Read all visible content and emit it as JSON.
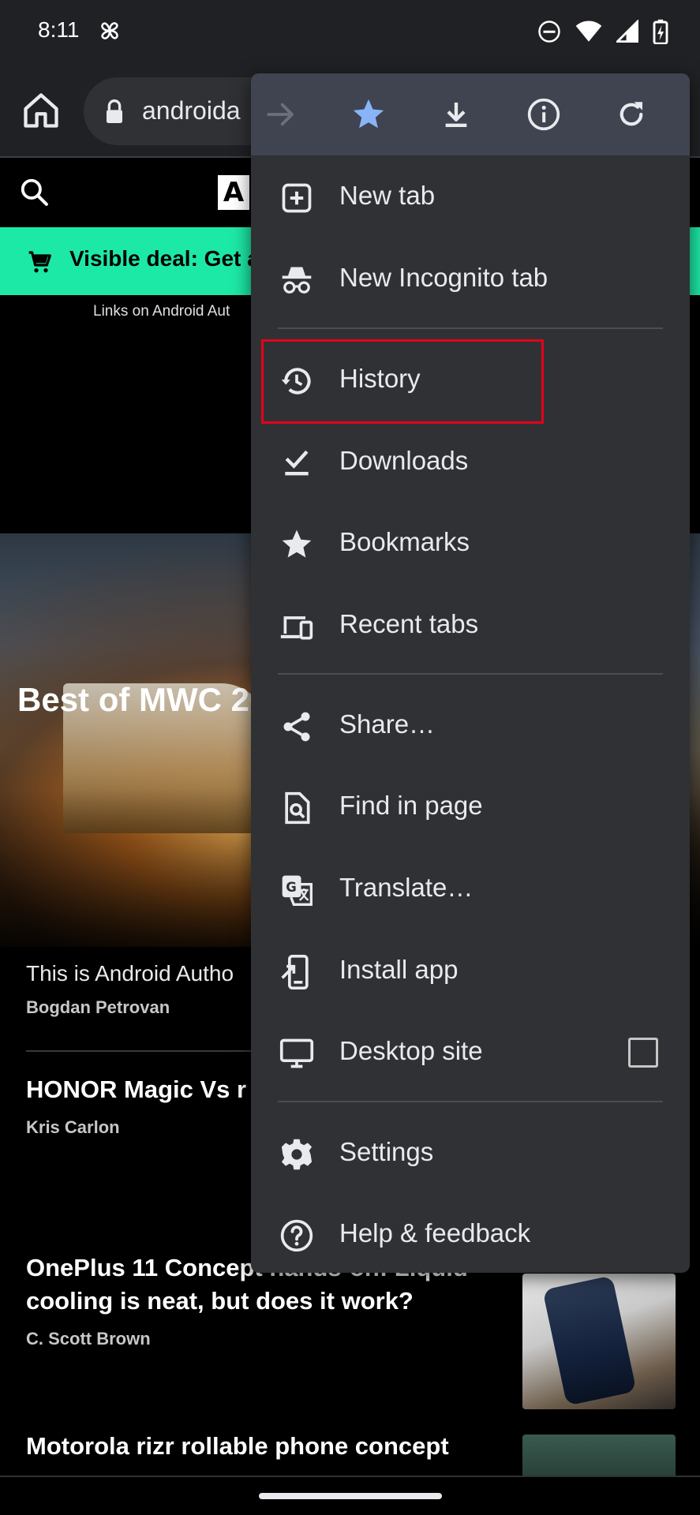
{
  "status_bar": {
    "time": "8:11",
    "icons": [
      "pinwheel-icon",
      "do-not-disturb-icon",
      "wifi-icon",
      "cellular-signal-icon",
      "battery-charging-icon"
    ]
  },
  "toolbar": {
    "url_text": "androida",
    "home_icon": "home-icon",
    "lock_icon": "lock-icon"
  },
  "page": {
    "site_logo_text": "A",
    "deal_text": "Visible deal: Get a",
    "affiliate_note": "Links on Android Aut",
    "hero_title": "Best of MWC 2023: products from",
    "articles": [
      {
        "title": "",
        "description": "This is Android Autho",
        "author": "Bogdan Petrovan"
      },
      {
        "title": "HONOR Magic Vs r believe in magic?",
        "author": "Kris Carlon"
      },
      {
        "title": "OnePlus 11 Concept hands-on: Liquid cooling is neat, but does it work?",
        "author": "C. Scott Brown"
      },
      {
        "title": "Motorola rizr rollable phone concept",
        "author": ""
      }
    ]
  },
  "menu": {
    "top_actions": [
      {
        "name": "forward-icon",
        "enabled": false
      },
      {
        "name": "bookmark-star-icon",
        "enabled": true
      },
      {
        "name": "download-icon",
        "enabled": true
      },
      {
        "name": "info-icon",
        "enabled": true
      },
      {
        "name": "refresh-icon",
        "enabled": true
      }
    ],
    "items": [
      {
        "label": "New tab",
        "icon": "new-tab-icon"
      },
      {
        "label": "New Incognito tab",
        "icon": "incognito-icon"
      },
      {
        "label": "History",
        "icon": "history-icon"
      },
      {
        "label": "Downloads",
        "icon": "downloads-icon"
      },
      {
        "label": "Bookmarks",
        "icon": "bookmarks-star-icon"
      },
      {
        "label": "Recent tabs",
        "icon": "recent-tabs-icon"
      },
      {
        "label": "Share…",
        "icon": "share-icon"
      },
      {
        "label": "Find in page",
        "icon": "find-in-page-icon"
      },
      {
        "label": "Translate…",
        "icon": "translate-icon"
      },
      {
        "label": "Install app",
        "icon": "install-app-icon"
      },
      {
        "label": "Desktop site",
        "icon": "desktop-icon",
        "checked": false
      },
      {
        "label": "Settings",
        "icon": "settings-gear-icon"
      },
      {
        "label": "Help & feedback",
        "icon": "help-icon"
      }
    ],
    "highlighted_item": "History",
    "colors": {
      "menu_bg": "#303134",
      "menu_top_bg": "#3f4450",
      "star_accent": "#8ab4f8",
      "highlight": "#e3001b"
    }
  },
  "colors": {
    "deal_banner": "#1de9a6",
    "toolbar_bg": "#202124"
  }
}
